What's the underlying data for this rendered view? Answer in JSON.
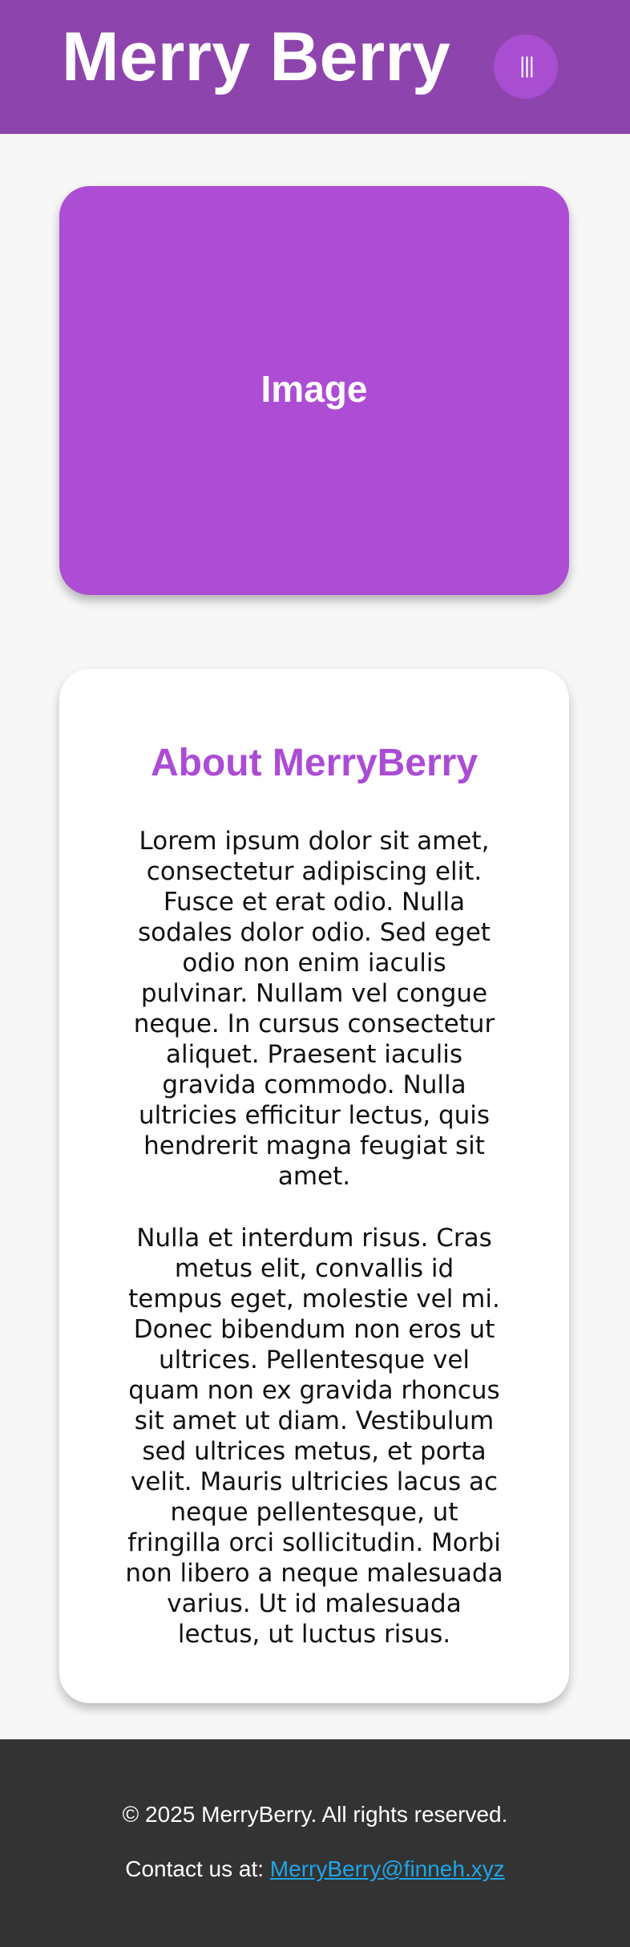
{
  "header": {
    "title": "Merry Berry",
    "menu_icon": "|||"
  },
  "hero": {
    "label": "Image"
  },
  "about": {
    "title": "About MerryBerry",
    "paragraph_1": "Lorem ipsum dolor sit amet, consectetur adipiscing elit. Fusce et erat odio. Nulla sodales dolor odio. Sed eget odio non enim iaculis pulvinar. Nullam vel congue neque. In cursus consectetur aliquet. Praesent iaculis gravida commodo. Nulla ultricies efficitur lectus, quis hendrerit magna feugiat sit amet.",
    "paragraph_2": "Nulla et interdum risus. Cras metus elit, convallis id tempus eget, molestie vel mi. Donec bibendum non eros ut ultrices. Pellentesque vel quam non ex gravida rhoncus sit amet ut diam. Vestibulum sed ultrices metus, et porta velit. Mauris ultricies lacus ac neque pellentesque, ut fringilla orci sollicitudin. Morbi non libero a neque malesuada varius. Ut id malesuada lectus, ut luctus risus."
  },
  "footer": {
    "copyright": "© 2025 MerryBerry. All rights reserved.",
    "contact_prefix": "Contact us at:",
    "contact_email": "MerryBerry@finneh.xyz"
  },
  "colors": {
    "header_background": "#8e44ad",
    "card_purple": "#ad4dd4",
    "title_purple": "#ab4cd5",
    "footer_background": "#333333",
    "link_blue": "#1fa5e6"
  }
}
